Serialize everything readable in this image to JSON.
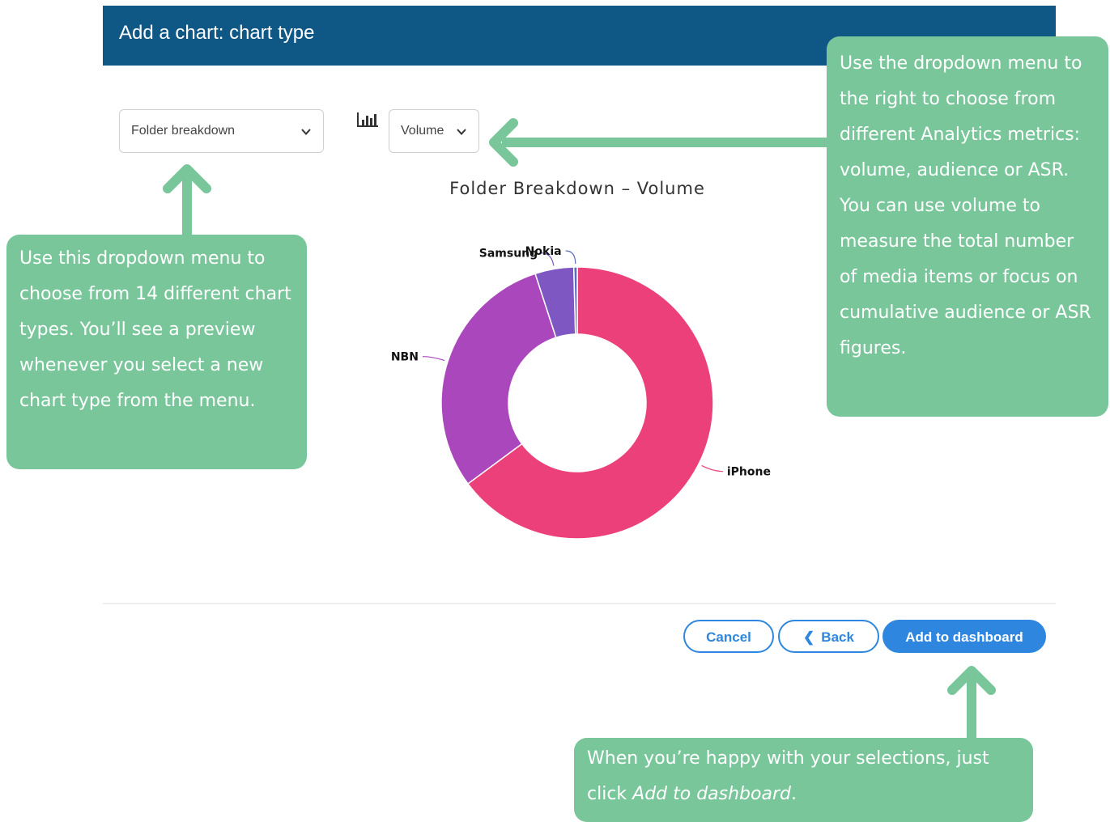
{
  "dialog": {
    "title": "Add a chart: chart type"
  },
  "controls": {
    "chart_type_select": {
      "value": "Folder breakdown"
    },
    "metric_select": {
      "value": "Volume"
    },
    "metric_icon": "bar-chart-icon"
  },
  "chart_data": {
    "type": "pie",
    "variant": "donut",
    "title": "Folder Breakdown – Volume",
    "categories": [
      "iPhone",
      "NBN",
      "Samsung",
      "Nokia"
    ],
    "values": [
      63.5,
      29.5,
      4.5,
      0.4
    ],
    "colors": [
      "#ec407a",
      "#ab47bc",
      "#7e57c2",
      "#5c6bc0"
    ]
  },
  "footer": {
    "cancel_label": "Cancel",
    "back_label": "Back",
    "back_icon": "chevron-left-icon",
    "add_label": "Add to dashboard"
  },
  "callouts": {
    "left": "Use this dropdown menu to choose from 14 different chart types. You’ll see a preview whenever you select a new chart type from the menu.",
    "right": "Use the dropdown menu to the right to choose from different Analytics metrics: volume, audience or ASR. You can use volume to measure the total number of media items or focus on cumulative audience or ASR figures.",
    "bottom_prefix": "When you’re happy with your selections, just click ",
    "bottom_emphasis": "Add to dashboard",
    "bottom_suffix": "."
  },
  "colors": {
    "header": "#0f5784",
    "primary": "#2e86de",
    "callout": "#7ac69b"
  }
}
